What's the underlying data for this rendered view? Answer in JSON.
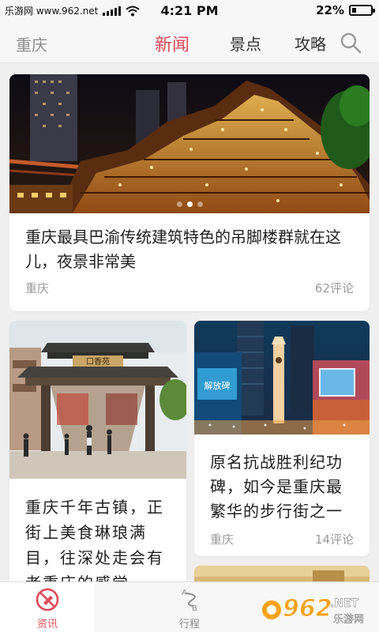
{
  "status_bar": {
    "carrier": "乐游网 www.962.net",
    "time": "4:21 PM",
    "battery": "22%"
  },
  "top_nav": {
    "city": "重庆",
    "tabs": [
      {
        "label": "新闻",
        "active": true
      },
      {
        "label": "景点",
        "active": false
      },
      {
        "label": "攻略",
        "active": false
      }
    ],
    "accent_color": "#e04a5a"
  },
  "feed": {
    "hero": {
      "title": "重庆最具巴渝传统建筑特色的吊脚楼群就在这儿，夜景非常美",
      "location": "重庆",
      "comments": "62评论",
      "carousel_pages": 3,
      "carousel_active": 1
    },
    "left_card": {
      "title": "重庆千年古镇，正街上美食琳琅满目，往深处走会有老重庆的感觉",
      "sign_text": "口香苑"
    },
    "right_card": {
      "title": "原名抗战胜利纪功碑，如今是重庆最繁华的步行街之一",
      "location": "重庆",
      "comments": "14评论",
      "billboard_text": "解放碑"
    }
  },
  "tab_bar": {
    "items": [
      {
        "label": "资讯",
        "icon": "news-icon",
        "active": true
      },
      {
        "label": "行程",
        "icon": "route-icon",
        "active": false
      }
    ]
  },
  "watermark": {
    "brand": "962",
    "suffix": ".NET",
    "site": "乐游网"
  }
}
